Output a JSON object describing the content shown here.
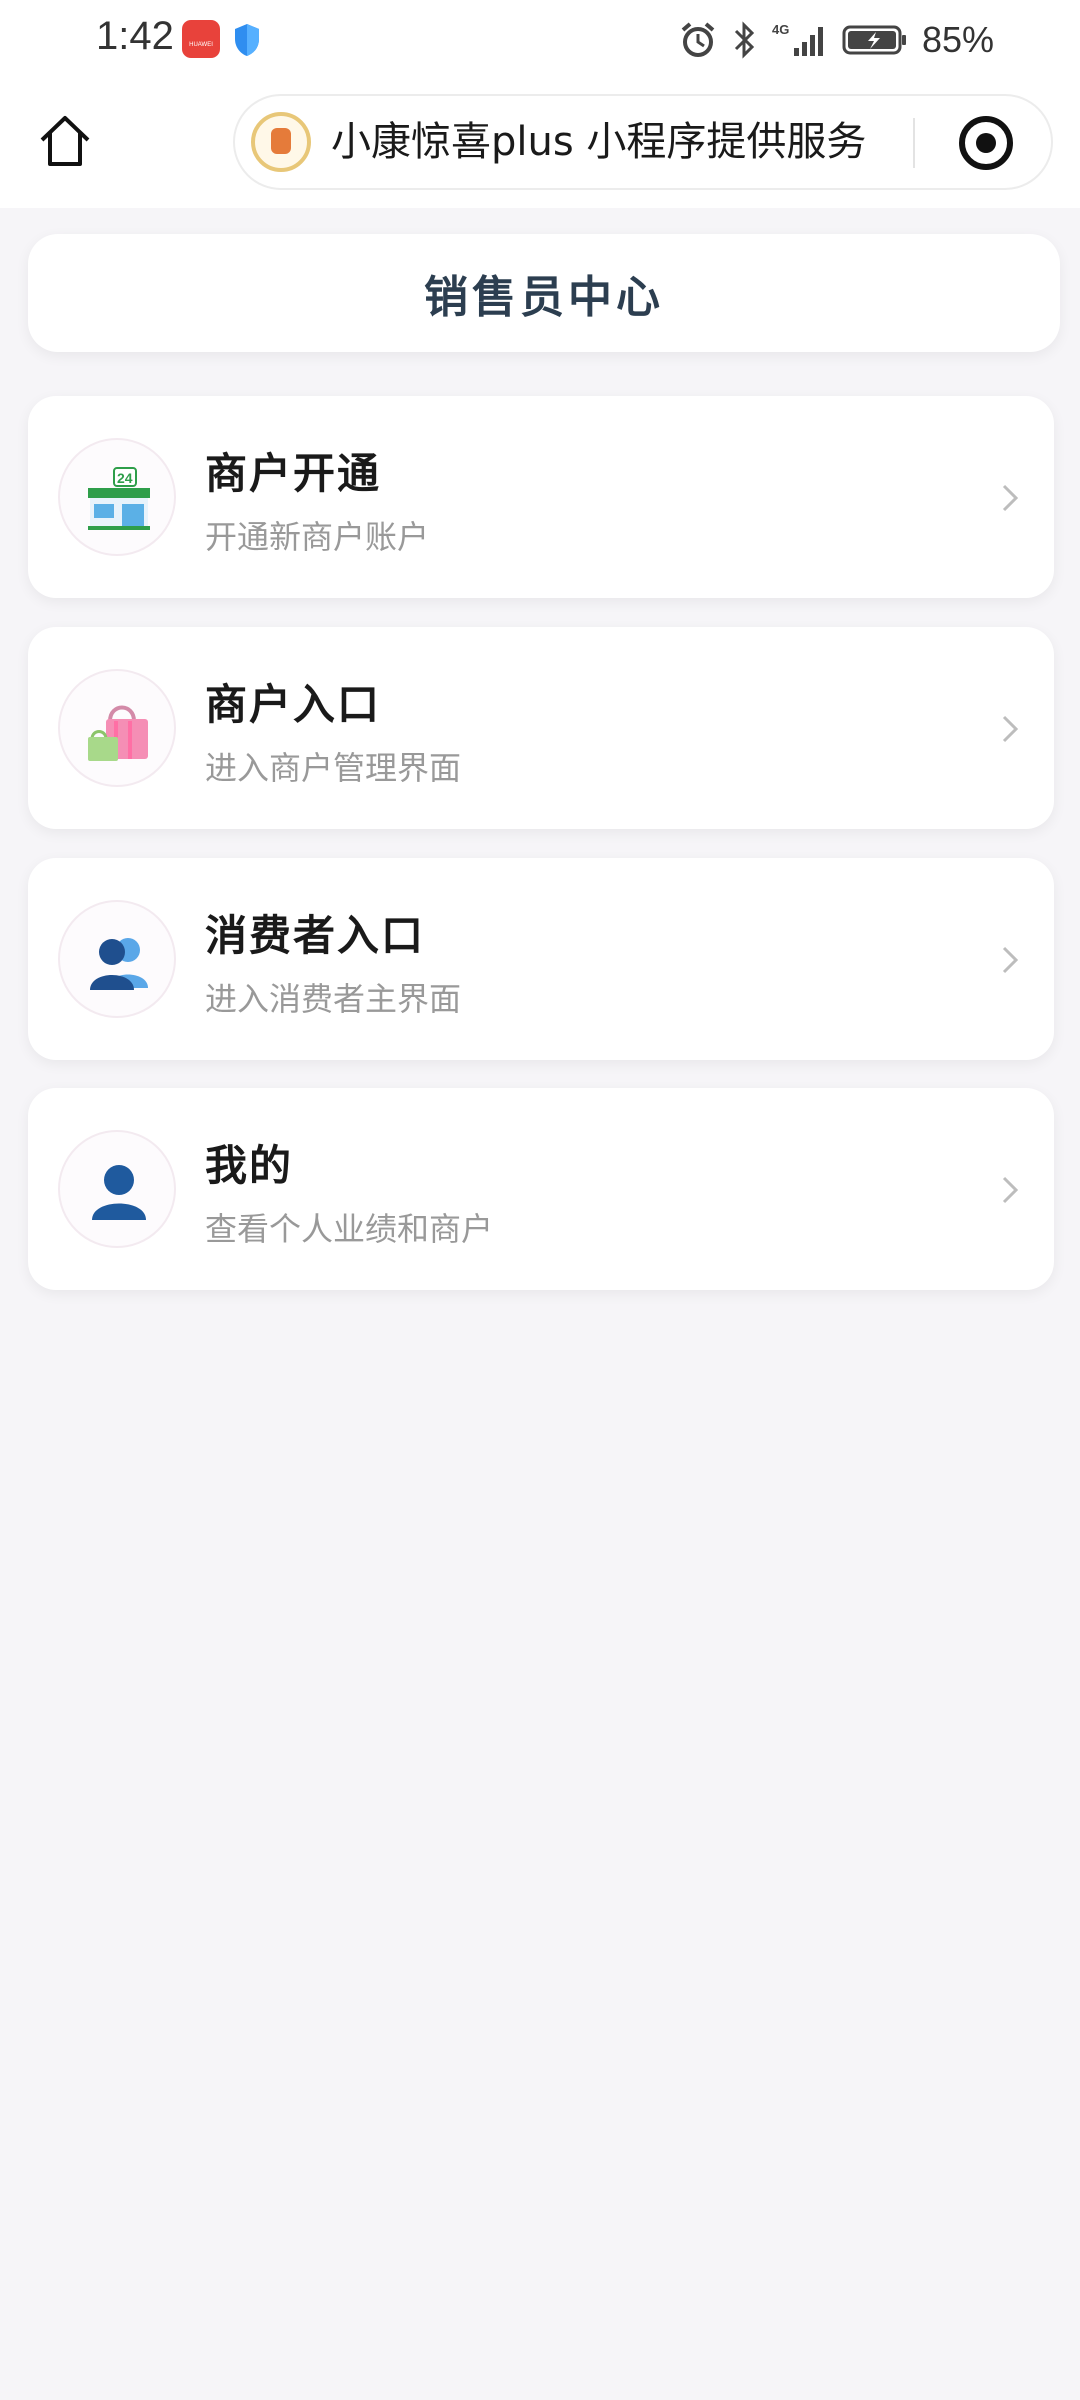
{
  "status_bar": {
    "time": "1:42",
    "app_badge": "HUAWEI",
    "battery_percent": "85%",
    "network": "4G"
  },
  "header": {
    "capsule_title": "小康惊喜plus 小程序提供服务"
  },
  "page": {
    "title": "销售员中心"
  },
  "menu": {
    "items": [
      {
        "title": "商户开通",
        "subtitle": "开通新商户账户",
        "icon": "store-24h-icon"
      },
      {
        "title": "商户入口",
        "subtitle": "进入商户管理界面",
        "icon": "shopping-bags-icon"
      },
      {
        "title": "消费者入口",
        "subtitle": "进入消费者主界面",
        "icon": "users-icon"
      },
      {
        "title": "我的",
        "subtitle": "查看个人业绩和商户",
        "icon": "user-icon"
      }
    ]
  },
  "colors": {
    "title_color": "#2c3e50",
    "subtitle_color": "#999999",
    "background": "#f6f5f8"
  }
}
